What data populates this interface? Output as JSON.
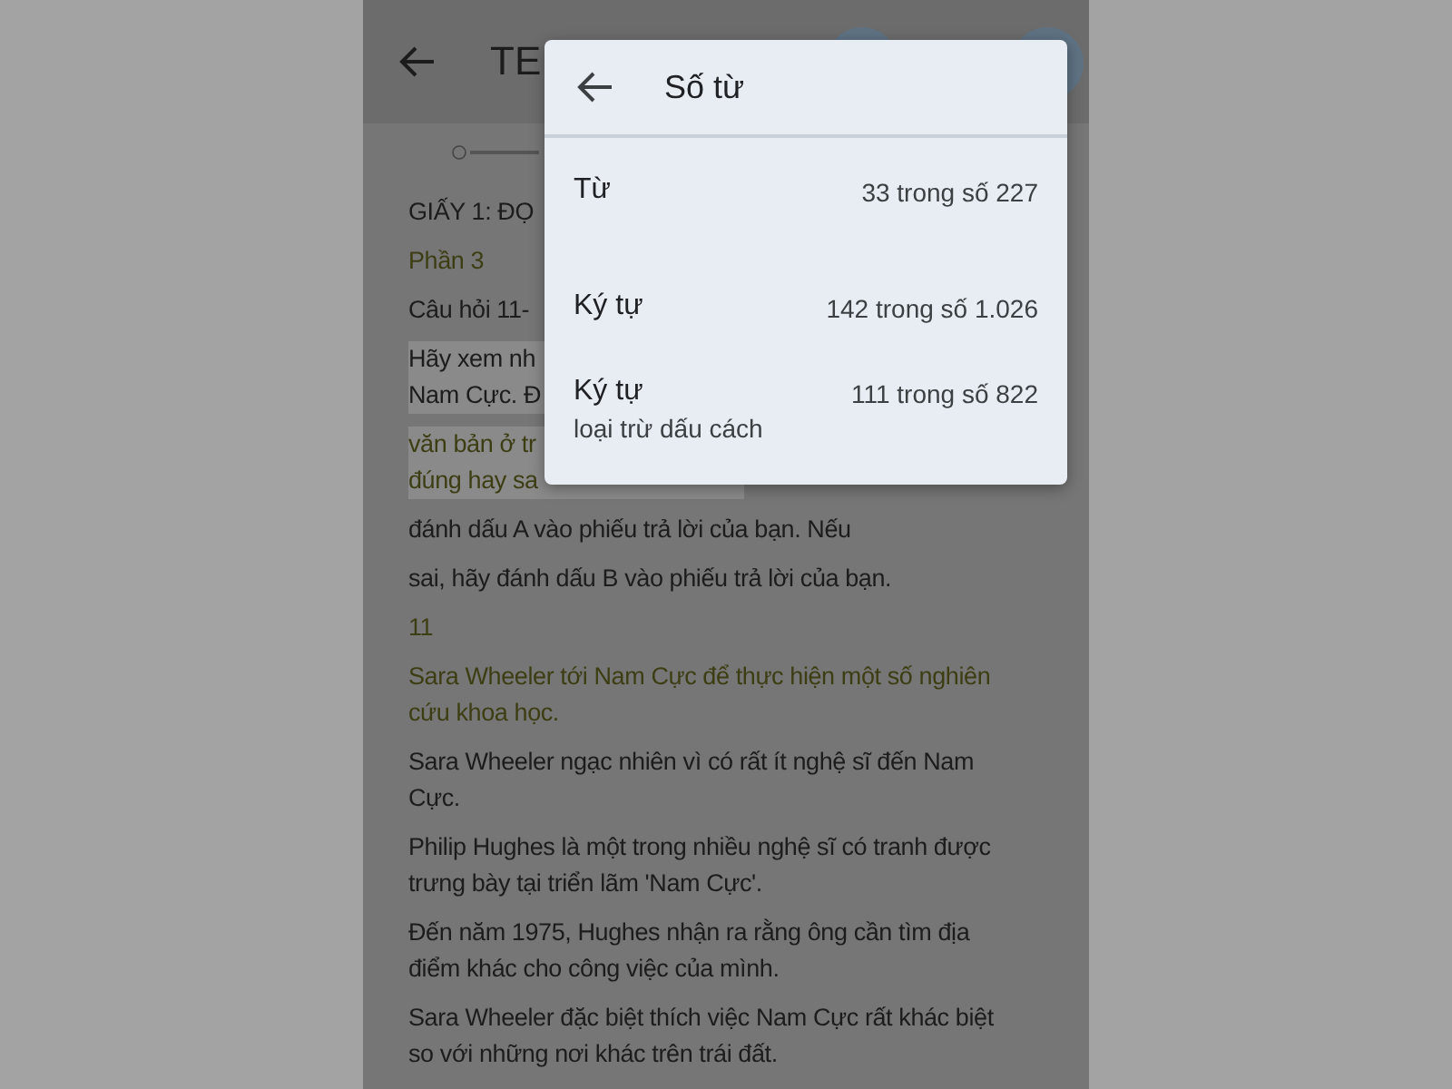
{
  "app_bar": {
    "title": "TE"
  },
  "document": {
    "paragraphs": [
      {
        "lines": [
          "GIẤY 1: ĐỌ"
        ],
        "color": "#1c1c1c",
        "selected": false
      },
      {
        "lines": [
          "Phần 3"
        ],
        "color": "#3d3d14",
        "selected": false
      },
      {
        "lines": [
          "Câu hỏi 11-"
        ],
        "color": "#1c1c1c",
        "selected": false
      },
      {
        "lines": [
          "Hãy xem nh",
          "Nam Cực. Đ"
        ],
        "color": "#1c1c1c",
        "selected": true
      },
      {
        "lines": [
          "văn bản ở tr",
          "đúng hay sa"
        ],
        "color": "#3d3d14",
        "selected": true
      },
      {
        "lines": [
          "đánh dấu A vào phiếu trả lời của bạn. Nếu"
        ],
        "color": "#1c1c1c",
        "selected": false
      },
      {
        "lines": [
          "sai, hãy đánh dấu B vào phiếu trả lời của bạn."
        ],
        "color": "#1c1c1c",
        "selected": false
      },
      {
        "lines": [
          "11"
        ],
        "color": "#3d3d14",
        "selected": false
      },
      {
        "lines": [
          "Sara Wheeler tới Nam Cực để thực hiện một số nghiên",
          "cứu khoa học."
        ],
        "color": "#3d3d14",
        "selected": false
      },
      {
        "lines": [
          "Sara Wheeler ngạc nhiên vì có rất ít nghệ sĩ đến Nam",
          "Cực."
        ],
        "color": "#1c1c1c",
        "selected": false
      },
      {
        "lines": [
          "Philip Hughes là một trong nhiều nghệ sĩ có tranh được",
          "trưng bày tại triển lãm 'Nam Cực'."
        ],
        "color": "#1c1c1c",
        "selected": false
      },
      {
        "lines": [
          "Đến năm 1975, Hughes nhận ra rằng ông cần tìm địa",
          "điểm khác cho công việc của mình."
        ],
        "color": "#1c1c1c",
        "selected": false
      },
      {
        "lines": [
          "Sara Wheeler đặc biệt thích việc Nam Cực rất khác biệt",
          "so với những nơi khác trên trái đất."
        ],
        "color": "#1c1c1c",
        "selected": false
      }
    ]
  },
  "dialog": {
    "title": "Số từ",
    "rows": [
      {
        "label": "Từ",
        "value": "33 trong số 227"
      },
      {
        "label": "Ký tự",
        "value": "142 trong số 1.026"
      },
      {
        "label": "Ký tự",
        "sublabel": "loại trừ dấu cách",
        "value": "111 trong số 822"
      }
    ]
  }
}
